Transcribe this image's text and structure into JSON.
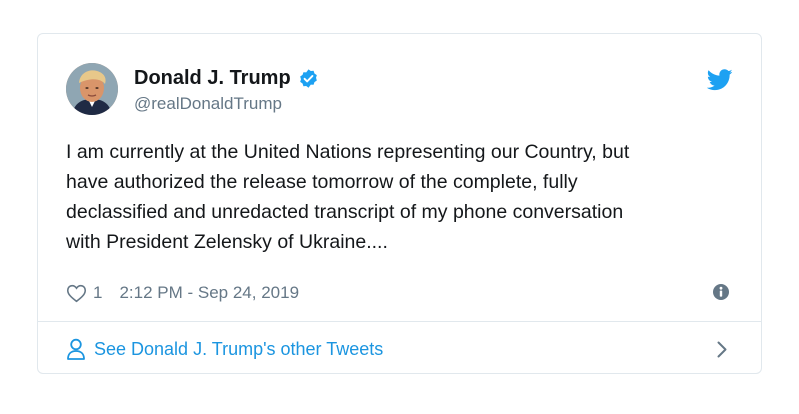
{
  "tweet": {
    "author": {
      "display_name": "Donald J. Trump",
      "handle": "@realDonaldTrump",
      "verified": true
    },
    "text": "I am currently at the United Nations representing our Country, but\nhave authorized the release tomorrow of the complete, fully\ndeclassified and unredacted transcript of my phone conversation\nwith President Zelensky of Ukraine....",
    "likes": "1",
    "timestamp": "2:12 PM - Sep 24, 2019",
    "footer_link": "See Donald J. Trump's other Tweets"
  },
  "colors": {
    "accent": "#1da1f2",
    "link": "#1b95e0",
    "muted": "#657786",
    "border": "#e1e8ed"
  },
  "icons": [
    "avatar",
    "verified-badge-icon",
    "twitter-bird-icon",
    "heart-icon",
    "info-icon",
    "person-icon",
    "chevron-right-icon"
  ]
}
